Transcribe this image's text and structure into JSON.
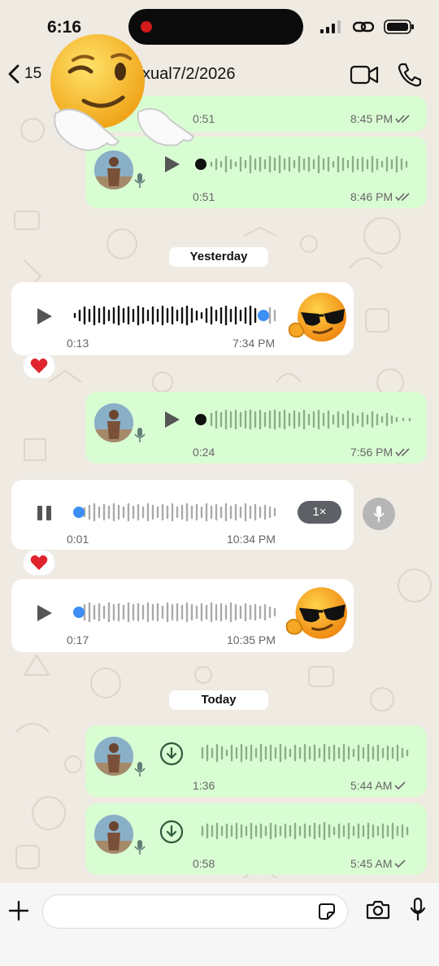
{
  "status_bar": {
    "time": "6:16"
  },
  "header": {
    "back_count": "15",
    "title": "xual7/2/2026"
  },
  "date_separators": {
    "yesterday": "Yesterday",
    "today": "Today"
  },
  "messages": [
    {
      "duration": "0:51",
      "time": "8:45 PM"
    },
    {
      "duration": "0:51",
      "time": "8:46 PM"
    },
    {
      "duration": "0:13",
      "time": "7:34 PM",
      "reaction": "heart"
    },
    {
      "duration": "0:24",
      "time": "7:56 PM"
    },
    {
      "duration": "0:01",
      "time": "10:34 PM",
      "speed": "1×",
      "reaction": "heart",
      "state": "playing"
    },
    {
      "duration": "0:17",
      "time": "10:35 PM"
    },
    {
      "duration": "1:36",
      "time": "5:44 AM"
    },
    {
      "duration": "0:58",
      "time": "5:45 AM"
    }
  ],
  "colors": {
    "outgoing": "#d9fdd3",
    "incoming": "#ffffff",
    "accent_blue": "#3d8ef5",
    "wallpaper": "#efeae2"
  },
  "icons": [
    "back-chevron-icon",
    "video-call-icon",
    "phone-icon",
    "play-icon",
    "pause-icon",
    "mic-icon",
    "download-icon",
    "double-check-icon",
    "single-check-icon",
    "heart-icon",
    "plus-icon",
    "sticker-icon",
    "camera-icon"
  ]
}
